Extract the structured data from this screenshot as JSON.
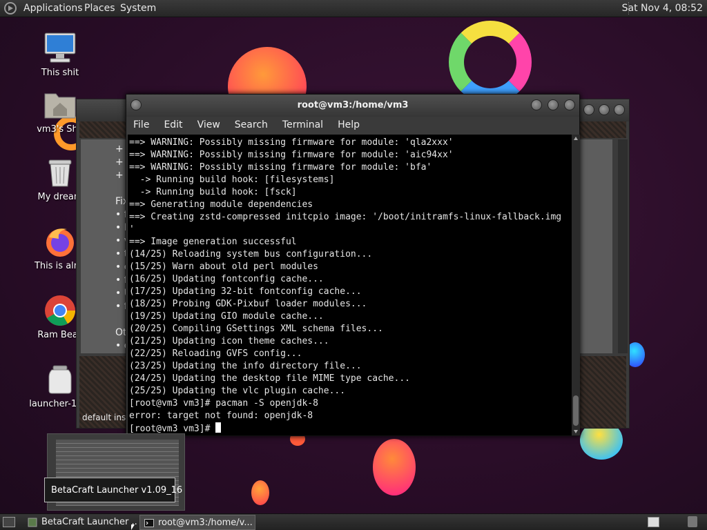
{
  "top_panel": {
    "menus": [
      "Applications",
      "Places",
      "System"
    ],
    "clock": "Sat Nov 4, 08:52"
  },
  "desktop_icons": [
    {
      "label": "This shit",
      "icon": "computer-icon"
    },
    {
      "label": "vm3's Sha",
      "icon": "home-folder-icon"
    },
    {
      "label": "My dream",
      "icon": "trash-icon"
    },
    {
      "label": "This is alrig",
      "icon": "firefox-icon"
    },
    {
      "label": "Ram Beas",
      "icon": "chrome-icon"
    },
    {
      "label": "launcher-1.09",
      "icon": "jar-file-icon"
    }
  ],
  "background_window": {
    "content_lines": [
      "+ C",
      "+ I",
      "+ I",
      "",
      "Fix",
      "• fi",
      "• D",
      "• v",
      "• th",
      "• c",
      "• fi",
      "• U",
      "• fi",
      "",
      "Ot",
      "• o"
    ],
    "status_text": "default ins"
  },
  "terminal": {
    "title": "root@vm3:/home/vm3",
    "menu": [
      "File",
      "Edit",
      "View",
      "Search",
      "Terminal",
      "Help"
    ],
    "lines": [
      "==> WARNING: Possibly missing firmware for module: 'qla2xxx'",
      "==> WARNING: Possibly missing firmware for module: 'aic94xx'",
      "==> WARNING: Possibly missing firmware for module: 'bfa'",
      "  -> Running build hook: [filesystems]",
      "  -> Running build hook: [fsck]",
      "==> Generating module dependencies",
      "==> Creating zstd-compressed initcpio image: '/boot/initramfs-linux-fallback.img",
      "'",
      "==> Image generation successful",
      "(14/25) Reloading system bus configuration...",
      "(15/25) Warn about old perl modules",
      "(16/25) Updating fontconfig cache...",
      "(17/25) Updating 32-bit fontconfig cache...",
      "(18/25) Probing GDK-Pixbuf loader modules...",
      "(19/25) Updating GIO module cache...",
      "(20/25) Compiling GSettings XML schema files...",
      "(21/25) Updating icon theme caches...",
      "(22/25) Reloading GVFS config...",
      "(23/25) Updating the info directory file...",
      "(24/25) Updating the desktop file MIME type cache...",
      "(25/25) Updating the vlc plugin cache...",
      "[root@vm3 vm3]# pacman -S openjdk-8",
      "error: target not found: openjdk-8"
    ],
    "prompt": "[root@vm3 vm3]# "
  },
  "tooltip": "BetaCraft Launcher v1.09_16",
  "taskbar": {
    "tasks": [
      {
        "label": "BetaCraft Launcher ...",
        "active": false
      },
      {
        "label": "root@vm3:/home/v...",
        "active": true
      }
    ]
  },
  "colors": {
    "wallpaper": "#2a0d28",
    "terminal_bg": "#000000",
    "terminal_fg": "#e6e6e6",
    "panel": "#2e2e2e"
  }
}
